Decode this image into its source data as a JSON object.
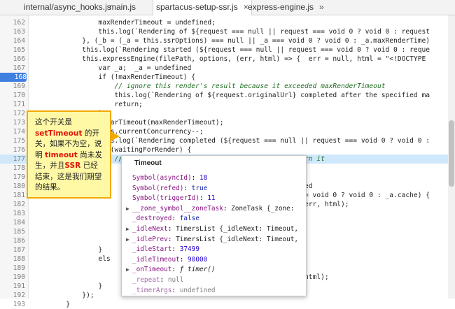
{
  "tabs": [
    {
      "label": "internal/async_hooks.js",
      "active": false
    },
    {
      "label": "main.js",
      "active": false
    },
    {
      "label": "spartacus-setup-ssr.js",
      "active": true,
      "close": "×"
    },
    {
      "label": "express-engine.js",
      "active": false
    },
    {
      "label": "»",
      "active": false
    }
  ],
  "breakpoint_line": "168",
  "lines": [
    {
      "n": "162",
      "code": "                maxRenderTimeout = undefined;"
    },
    {
      "n": "163",
      "code": "                this.log(`Rendering of ${request === null || request === void 0 ? void 0 : request"
    },
    {
      "n": "164",
      "code": "            }, (_b = (_a = this.ssrOptions) === null || _a === void 0 ? void 0 : _a.maxRenderTime)"
    },
    {
      "n": "165",
      "code": "            this.log(`Rendering started (${request === null || request === void 0 ? void 0 : reque"
    },
    {
      "n": "166",
      "code": "            this.expressEngine(filePath, options, (err, html) => {  err = null, html = \"<!DOCTYPE"
    },
    {
      "n": "167",
      "code": "                var _a;  _a = undefined"
    },
    {
      "n": "168",
      "code": "                if (!maxRenderTimeout) {"
    },
    {
      "n": "169",
      "code": "                    // ignore this render's result because it exceeded maxRenderTimeout"
    },
    {
      "n": "170",
      "code": "                    this.log(`Rendering of ${request.originalUrl} completed after the specified ma"
    },
    {
      "n": "171",
      "code": "                    return;"
    },
    {
      "n": "172",
      "code": "                }"
    },
    {
      "n": "173",
      "code": "                clearTimeout(maxRenderTimeout);"
    },
    {
      "n": "174",
      "code": "                this.currentConcurrency--;"
    },
    {
      "n": "175",
      "code": "                this.log(`Rendering completed (${request === null || request === void 0 ? void 0 :"
    },
    {
      "n": "176",
      "code": "                if (waitingForRender) {"
    },
    {
      "n": "177",
      "code": "                    // if request is still waiting for render, return it"
    },
    {
      "n": "178",
      "code": ""
    },
    {
      "n": "179",
      "code": ""
    },
    {
      "n": "180",
      "code": "                                                                   ed"
    },
    {
      "n": "181",
      "code": "                                                                   = void 0 ? void 0 : _a.cache) {"
    },
    {
      "n": "182",
      "code": "                                                                   err, html);"
    },
    {
      "n": "183",
      "code": ""
    },
    {
      "n": "184",
      "code": ""
    },
    {
      "n": "185",
      "code": ""
    },
    {
      "n": "186",
      "code": ""
    },
    {
      "n": "187",
      "code": "                }"
    },
    {
      "n": "188",
      "code": "                els"
    },
    {
      "n": "189",
      "code": ""
    },
    {
      "n": "190",
      "code": "                                                                   html);"
    },
    {
      "n": "191",
      "code": "                }"
    },
    {
      "n": "192",
      "code": "            });"
    },
    {
      "n": "193",
      "code": "        }"
    }
  ],
  "note": {
    "line1": "这个开关是",
    "hot1": "setTimeout",
    "line2": " 的开关，如果不为空，说明 ",
    "hot2": "timeout",
    "line3": " 尚未发生，并且",
    "hot3": "SSR",
    "line4": " 已经结束，这是我们期望的结果。"
  },
  "popup": {
    "title": "Timeout",
    "props": [
      {
        "expand": false,
        "key": "Symbol(asyncId)",
        "sep": ": ",
        "value": "18",
        "kind": "num",
        "dim": false
      },
      {
        "expand": false,
        "key": "Symbol(refed)",
        "sep": ": ",
        "value": "true",
        "kind": "kwv",
        "dim": false
      },
      {
        "expand": false,
        "key": "Symbol(triggerId)",
        "sep": ": ",
        "value": "11",
        "kind": "num",
        "dim": false
      },
      {
        "expand": true,
        "key": "__zone_symbol__zoneTask",
        "sep": ": ",
        "value": "ZoneTask {_zone:",
        "kind": "obj",
        "dim": false
      },
      {
        "expand": false,
        "key": "_destroyed",
        "sep": ": ",
        "value": "false",
        "kind": "kwv",
        "dim": false
      },
      {
        "expand": true,
        "key": "_idleNext",
        "sep": ": ",
        "value": "TimersList {_idleNext: Timeout,",
        "kind": "obj",
        "dim": false
      },
      {
        "expand": true,
        "key": "_idlePrev",
        "sep": ": ",
        "value": "TimersList {_idleNext: Timeout,",
        "kind": "obj",
        "dim": false
      },
      {
        "expand": false,
        "key": "_idleStart",
        "sep": ": ",
        "value": "37499",
        "kind": "num",
        "dim": false
      },
      {
        "expand": false,
        "key": "_idleTimeout",
        "sep": ": ",
        "value": "90000",
        "kind": "num",
        "dim": false
      },
      {
        "expand": true,
        "key": "_onTimeout",
        "sep": ": ",
        "value": "ƒ timer()",
        "kind": "fn",
        "dim": false
      },
      {
        "expand": false,
        "key": "_repeat",
        "sep": ": ",
        "value": "null",
        "kind": "gray",
        "dim": true
      },
      {
        "expand": false,
        "key": "_timerArgs",
        "sep": ": ",
        "value": "undefined",
        "kind": "gray",
        "dim": true
      }
    ]
  }
}
